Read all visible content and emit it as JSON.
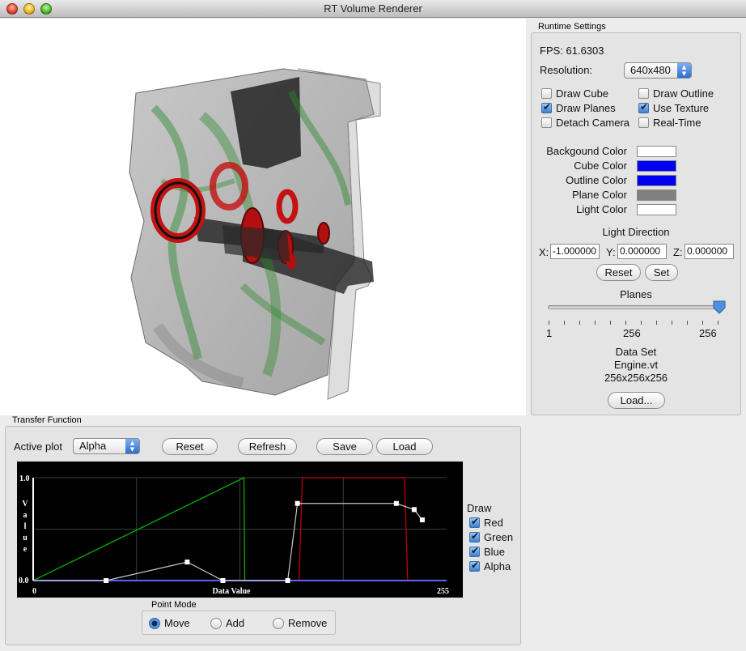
{
  "window": {
    "title": "RT Volume Renderer"
  },
  "runtime": {
    "group_label": "Runtime Settings",
    "fps": "FPS: 61.6303",
    "resolution_label": "Resolution:",
    "resolution_value": "640x480",
    "checkboxes": [
      {
        "label": "Draw Cube",
        "checked": false
      },
      {
        "label": "Draw Outline",
        "checked": false
      },
      {
        "label": "Draw Planes",
        "checked": true
      },
      {
        "label": "Use Texture",
        "checked": true
      },
      {
        "label": "Detach Camera",
        "checked": false
      },
      {
        "label": "Real-Time",
        "checked": false
      }
    ],
    "colors": [
      {
        "label": "Backgound Color",
        "color": "#ffffff"
      },
      {
        "label": "Cube Color",
        "color": "#0000f0"
      },
      {
        "label": "Outline Color",
        "color": "#0000f0"
      },
      {
        "label": "Plane Color",
        "color": "#808080"
      },
      {
        "label": "Light Color",
        "color": "#ffffff"
      }
    ],
    "light_direction": {
      "label": "Light Direction",
      "x_label": "X:",
      "x_value": "-1.000000",
      "y_label": "Y:",
      "y_value": "0.000000",
      "z_label": "Z:",
      "z_value": "0.000000",
      "reset_label": "Reset",
      "set_label": "Set"
    },
    "planes": {
      "label": "Planes",
      "value_fraction": 1.0,
      "tick_labels": [
        "1",
        "256",
        "256"
      ]
    },
    "dataset": {
      "label": "Data Set",
      "name": "Engine.vt",
      "dims": "256x256x256",
      "load_label": "Load..."
    }
  },
  "transfer": {
    "group_label": "Transfer Function",
    "active_plot_label": "Active plot",
    "active_plot_value": "Alpha",
    "buttons": {
      "reset": "Reset",
      "refresh": "Refresh",
      "save": "Save",
      "load": "Load"
    },
    "plot": {
      "y_top": "1.0",
      "y_bottom": "0.0",
      "ylabel": "Value",
      "xlabel": "Data Value",
      "x_min": "0",
      "x_max": "255"
    },
    "draw": {
      "label": "Draw",
      "items": [
        {
          "label": "Red",
          "checked": true
        },
        {
          "label": "Green",
          "checked": true
        },
        {
          "label": "Blue",
          "checked": true
        },
        {
          "label": "Alpha",
          "checked": true
        }
      ]
    },
    "point_mode": {
      "label": "Point Mode",
      "options": [
        {
          "label": "Move",
          "selected": true
        },
        {
          "label": "Add",
          "selected": false
        },
        {
          "label": "Remove",
          "selected": false
        }
      ]
    }
  },
  "chart_data": {
    "type": "line",
    "xlabel": "Data Value",
    "ylabel": "Value",
    "xlim": [
      0,
      255
    ],
    "ylim": [
      0,
      1
    ],
    "series": [
      {
        "name": "Red",
        "color": "#cc0000",
        "x": [
          0,
          164,
          166,
          229,
          231,
          255
        ],
        "y": [
          0,
          0,
          1,
          1,
          0,
          0
        ]
      },
      {
        "name": "Green",
        "color": "#00c000",
        "x": [
          0,
          130,
          130.5,
          255
        ],
        "y": [
          0,
          1,
          0,
          0
        ]
      },
      {
        "name": "Blue",
        "color": "#6060ff",
        "x": [
          0,
          255
        ],
        "y": [
          0,
          0
        ]
      },
      {
        "name": "Alpha",
        "color": "#c8c8c8",
        "x": [
          0,
          45,
          95,
          117,
          157,
          163,
          224,
          235,
          240
        ],
        "y": [
          0,
          0,
          0.18,
          0,
          0,
          0.75,
          0.75,
          0.69,
          0.59
        ]
      }
    ]
  }
}
